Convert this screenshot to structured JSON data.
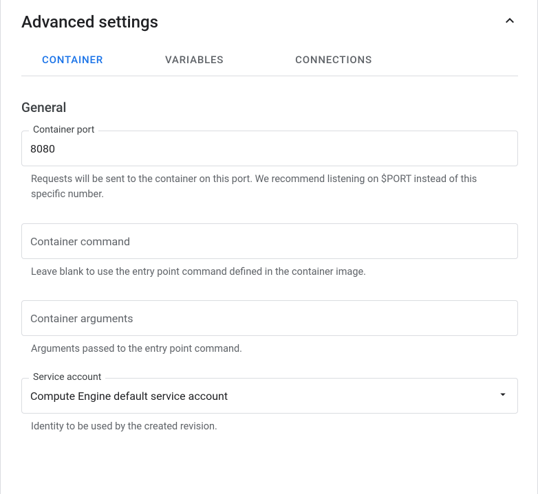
{
  "header": {
    "title": "Advanced settings"
  },
  "tabs": {
    "container": "CONTAINER",
    "variables": "VARIABLES",
    "connections": "CONNECTIONS"
  },
  "general": {
    "title": "General",
    "port": {
      "label": "Container port",
      "value": "8080",
      "helper": "Requests will be sent to the container on this port. We recommend listening on $PORT instead of this specific number."
    },
    "command": {
      "placeholder": "Container command",
      "value": "",
      "helper": "Leave blank to use the entry point command defined in the container image."
    },
    "args": {
      "placeholder": "Container arguments",
      "value": "",
      "helper": "Arguments passed to the entry point command."
    },
    "serviceAccount": {
      "label": "Service account",
      "value": "Compute Engine default service account",
      "helper": "Identity to be used by the created revision."
    }
  }
}
